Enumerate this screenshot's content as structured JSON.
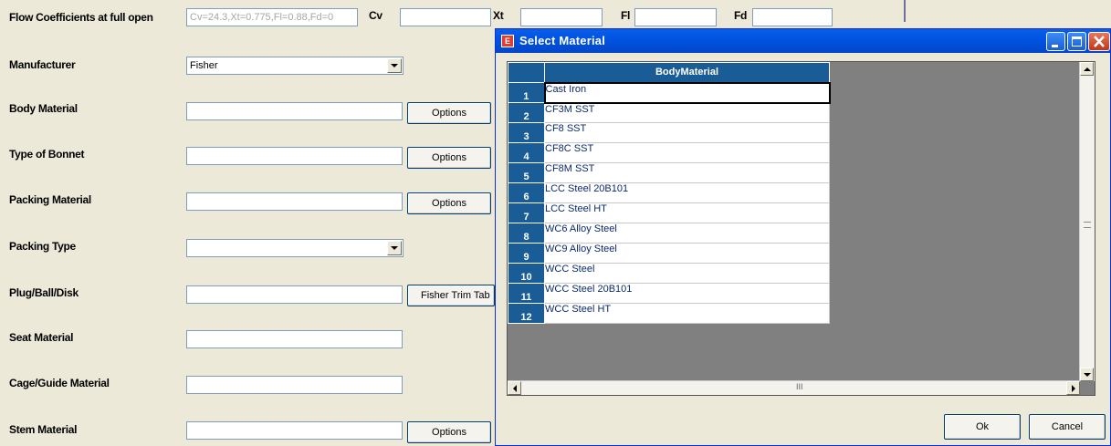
{
  "form": {
    "flow_label": "Flow Coefficients at full open",
    "flow_value": "Cv=24.3,Xt=0.775,Fl=0.88,Fd=0",
    "cv_label": "Cv",
    "xt_label": "Xt",
    "fl_label": "Fl",
    "fd_label": "Fd",
    "manufacturer_label": "Manufacturer",
    "manufacturer_value": "Fisher",
    "body_material_label": "Body Material",
    "type_of_bonnet_label": "Type of Bonnet",
    "packing_material_label": "Packing Material",
    "packing_type_label": "Packing Type",
    "plug_label": "Plug/Ball/Disk",
    "seat_material_label": "Seat Material",
    "cage_label": "Cage/Guide Material",
    "stem_material_label": "Stem Material",
    "options_label": "Options",
    "fisher_trim_label": "Fisher Trim Tab"
  },
  "dialog": {
    "title": "Select Material",
    "column_header": "BodyMaterial",
    "rows": [
      {
        "num": "1",
        "value": "Cast Iron"
      },
      {
        "num": "2",
        "value": "CF3M SST"
      },
      {
        "num": "3",
        "value": "CF8 SST"
      },
      {
        "num": "4",
        "value": "CF8C SST"
      },
      {
        "num": "5",
        "value": "CF8M SST"
      },
      {
        "num": "6",
        "value": "LCC Steel 20B101"
      },
      {
        "num": "7",
        "value": "LCC Steel HT"
      },
      {
        "num": "8",
        "value": "WC6 Alloy Steel"
      },
      {
        "num": "9",
        "value": "WC9 Alloy Steel"
      },
      {
        "num": "10",
        "value": "WCC Steel"
      },
      {
        "num": "11",
        "value": "WCC Steel 20B101"
      },
      {
        "num": "12",
        "value": "WCC Steel HT"
      }
    ],
    "ok_label": "Ok",
    "cancel_label": "Cancel",
    "scroll_grip": "III",
    "app_icon": "E"
  }
}
